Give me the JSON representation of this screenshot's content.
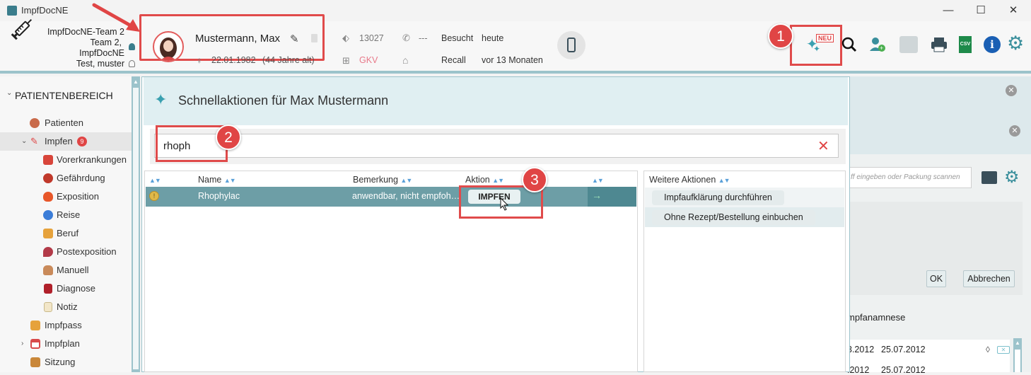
{
  "window": {
    "title": "ImpfDocNE",
    "controls": {
      "minimize": "—",
      "maximize": "☐",
      "close": "✕"
    }
  },
  "header": {
    "team_lines": [
      "ImpfDocNE-Team 2",
      "Team 2,",
      "ImpfDocNE",
      "Test, muster"
    ],
    "patient": {
      "name": "Mustermann, Max",
      "dob": "22.01.1982",
      "age": "(44 Jahre alt)",
      "id": "13027",
      "phone": "---",
      "insurance": "GKV"
    },
    "visit": {
      "visited_label": "Besucht",
      "visited_value": "heute",
      "recall_label": "Recall",
      "recall_value": "vor 13 Monaten"
    },
    "neu_label": "NEU"
  },
  "callouts": [
    "1",
    "2",
    "3"
  ],
  "sidebar": {
    "section": "PATIENTENBEREICH",
    "items": [
      {
        "label": "Patienten",
        "icon": "patients-icon"
      },
      {
        "label": "Impfen",
        "icon": "syringe-icon",
        "badge": "9"
      },
      {
        "label": "Vorerkrankungen",
        "icon": "heart-icon"
      },
      {
        "label": "Gefährdung",
        "icon": "virus-icon"
      },
      {
        "label": "Exposition",
        "icon": "fire-icon"
      },
      {
        "label": "Reise",
        "icon": "globe-icon"
      },
      {
        "label": "Beruf",
        "icon": "tools-icon"
      },
      {
        "label": "Postexposition",
        "icon": "shield-icon"
      },
      {
        "label": "Manuell",
        "icon": "hand-icon"
      },
      {
        "label": "Diagnose",
        "icon": "book-icon"
      },
      {
        "label": "Notiz",
        "icon": "note-icon"
      },
      {
        "label": "Impfpass",
        "icon": "passport-icon"
      },
      {
        "label": "Impfplan",
        "icon": "calendar-icon"
      },
      {
        "label": "Sitzung",
        "icon": "briefcase-icon"
      }
    ]
  },
  "dialog": {
    "title": "Schnellaktionen für Max Mustermann",
    "search_value": "rhoph",
    "table": {
      "columns": [
        "Name",
        "Bemerkung",
        "Aktion"
      ],
      "rows": [
        {
          "name": "Rhophylac",
          "remark": "anwendbar, nicht empfoh…",
          "action": "IMPFEN"
        }
      ]
    },
    "more_actions": {
      "header": "Weitere Aktionen",
      "items": [
        "Impfaufklärung durchführen",
        "Ohne Rezept/Bestellung einbuchen"
      ]
    }
  },
  "background_panel": {
    "search_placeholder": "ff eingeben oder Packung scannen",
    "ok": "OK",
    "cancel": "Abbrechen",
    "section": "mpfanamnese",
    "dates_row1": [
      "3.2012",
      "25.07.2012"
    ],
    "dates_row2": [
      ".2012",
      "25.07.2012"
    ],
    "csv_label": "CSV"
  },
  "colors": {
    "accent": "#9cc3cb",
    "selected_row": "#6d9ea6",
    "highlight_red": "#e04b4b"
  }
}
